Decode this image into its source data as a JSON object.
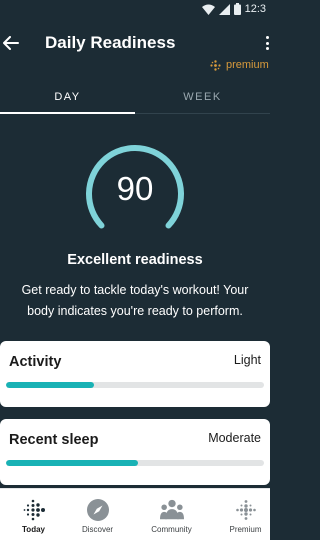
{
  "status_bar": {
    "time": "12:3"
  },
  "header": {
    "title": "Daily Readiness",
    "premium_label": "premium"
  },
  "tabs": [
    {
      "label": "DAY",
      "active": true
    },
    {
      "label": "WEEK",
      "active": false
    }
  ],
  "score": {
    "value": "90",
    "title": "Excellent readiness",
    "description": "Get ready to tackle today's workout! Your body indicates you're ready to perform."
  },
  "cards": {
    "activity": {
      "title": "Activity",
      "value": "Light",
      "progress": 0.34
    },
    "sleep": {
      "title": "Recent sleep",
      "value": "Moderate",
      "progress": 0.51
    }
  },
  "bottom_nav": [
    {
      "label": "Today",
      "icon": "fitbit-dots-icon",
      "active": true
    },
    {
      "label": "Discover",
      "icon": "compass-icon",
      "active": false
    },
    {
      "label": "Community",
      "icon": "community-icon",
      "active": false
    },
    {
      "label": "Premium",
      "icon": "premium-dots-icon",
      "active": false
    }
  ],
  "colors": {
    "background": "#1c2c35",
    "accent": "#19b2b5",
    "ring": "#7fd3d9",
    "premium": "#d79a3c"
  }
}
